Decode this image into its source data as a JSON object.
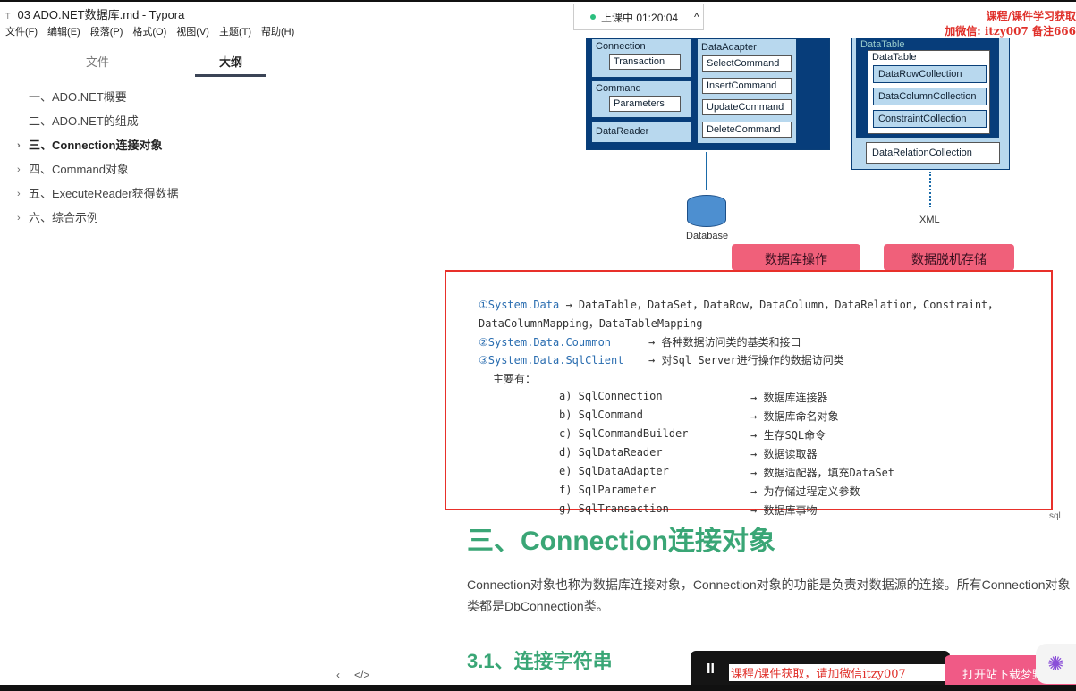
{
  "window": {
    "title": "03 ADO.NET数据库.md - Typora",
    "app_icon": "T"
  },
  "menu": [
    "文件(F)",
    "编辑(E)",
    "段落(P)",
    "格式(O)",
    "视图(V)",
    "主题(T)",
    "帮助(H)"
  ],
  "sidebar": {
    "tabs": [
      {
        "label": "文件"
      },
      {
        "label": "大纲",
        "active": true
      }
    ],
    "outline": [
      {
        "label": "一、ADO.NET概要",
        "chevron": false
      },
      {
        "label": "二、ADO.NET的组成",
        "chevron": false
      },
      {
        "label": "三、Connection连接对象",
        "chevron": true,
        "active": true
      },
      {
        "label": "四、Command对象",
        "chevron": true
      },
      {
        "label": "五、ExecuteReader获得数据",
        "chevron": true
      },
      {
        "label": "六、综合示例",
        "chevron": true
      }
    ],
    "footer": {
      "back": "‹",
      "source": "</>"
    }
  },
  "live": {
    "status": "上课中 01:20:04",
    "chevron": "^"
  },
  "watermark_top": [
    "课程/课件学习获取",
    "加微信: itzy007 备注666"
  ],
  "diagram": {
    "connection": "Connection",
    "transaction": "Transaction",
    "command": "Command",
    "parameters": "Parameters",
    "datareader": "DataReader",
    "dataadapter": "DataAdapter",
    "select": "SelectCommand",
    "insert": "InsertCommand",
    "update": "UpdateCommand",
    "delete": "DeleteCommand",
    "datatable_outer": "DataTable",
    "datatable": "DataTable",
    "rows": "DataRowCollection",
    "cols": "DataColumnCollection",
    "constraints": "ConstraintCollection",
    "relations": "DataRelationCollection",
    "database": "Database",
    "xml": "XML",
    "callout_db": "数据库操作",
    "callout_offline": "数据脱机存储"
  },
  "code": {
    "l1_ns": "①System.Data",
    "l1_txt": "→ DataTable，DataSet，DataRow，DataColumn，DataRelation，Constraint，",
    "l2": "DataColumnMapping，DataTableMapping",
    "l3_ns": "②System.Data.Coummon",
    "l3_txt": "→ 各种数据访问类的基类和接口",
    "l4_ns": "③System.Data.SqlClient",
    "l4_txt": "→ 对Sql Server进行操作的数据访问类",
    "main": "主要有：",
    "items": [
      {
        "k": "a) SqlConnection",
        "v": "→ 数据库连接器"
      },
      {
        "k": "b) SqlCommand",
        "v": "→ 数据库命名对象"
      },
      {
        "k": "c) SqlCommandBuilder",
        "v": "→ 生存SQL命令"
      },
      {
        "k": "d) SqlDataReader",
        "v": "→ 数据读取器"
      },
      {
        "k": "e) SqlDataAdapter",
        "v": "→ 数据适配器，填充DataSet"
      },
      {
        "k": "f) SqlParameter",
        "v": "→ 为存储过程定义参数"
      },
      {
        "k": "g) SqlTransaction",
        "v": "→ 数据库事物"
      }
    ]
  },
  "sql_tag": "sql",
  "doc": {
    "h2": "三、Connection连接对象",
    "para1": "Connection对象也称为数据库连接对象，Connection对象的功能是负责对数据源的连接。所有Connection对象",
    "para2": "类都是DbConnection类。",
    "h3": "3.1、连接字符串"
  },
  "player": {
    "pause": "II",
    "watermark": "课程/课件获取，请加微信itzy007",
    "open_button": "打开站下载梦野"
  }
}
